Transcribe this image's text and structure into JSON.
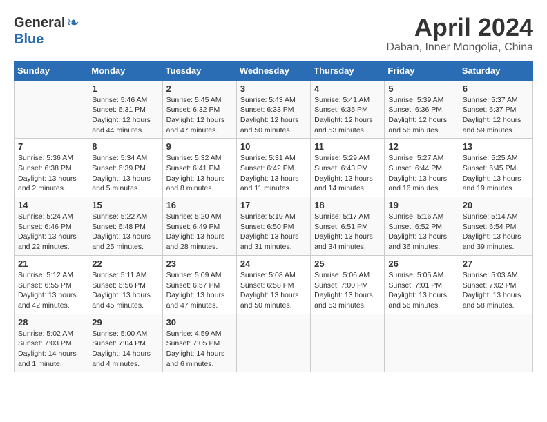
{
  "header": {
    "logo_general": "General",
    "logo_blue": "Blue",
    "month": "April 2024",
    "location": "Daban, Inner Mongolia, China"
  },
  "weekdays": [
    "Sunday",
    "Monday",
    "Tuesday",
    "Wednesday",
    "Thursday",
    "Friday",
    "Saturday"
  ],
  "weeks": [
    [
      {
        "day": "",
        "info": ""
      },
      {
        "day": "1",
        "info": "Sunrise: 5:46 AM\nSunset: 6:31 PM\nDaylight: 12 hours\nand 44 minutes."
      },
      {
        "day": "2",
        "info": "Sunrise: 5:45 AM\nSunset: 6:32 PM\nDaylight: 12 hours\nand 47 minutes."
      },
      {
        "day": "3",
        "info": "Sunrise: 5:43 AM\nSunset: 6:33 PM\nDaylight: 12 hours\nand 50 minutes."
      },
      {
        "day": "4",
        "info": "Sunrise: 5:41 AM\nSunset: 6:35 PM\nDaylight: 12 hours\nand 53 minutes."
      },
      {
        "day": "5",
        "info": "Sunrise: 5:39 AM\nSunset: 6:36 PM\nDaylight: 12 hours\nand 56 minutes."
      },
      {
        "day": "6",
        "info": "Sunrise: 5:37 AM\nSunset: 6:37 PM\nDaylight: 12 hours\nand 59 minutes."
      }
    ],
    [
      {
        "day": "7",
        "info": "Sunrise: 5:36 AM\nSunset: 6:38 PM\nDaylight: 13 hours\nand 2 minutes."
      },
      {
        "day": "8",
        "info": "Sunrise: 5:34 AM\nSunset: 6:39 PM\nDaylight: 13 hours\nand 5 minutes."
      },
      {
        "day": "9",
        "info": "Sunrise: 5:32 AM\nSunset: 6:41 PM\nDaylight: 13 hours\nand 8 minutes."
      },
      {
        "day": "10",
        "info": "Sunrise: 5:31 AM\nSunset: 6:42 PM\nDaylight: 13 hours\nand 11 minutes."
      },
      {
        "day": "11",
        "info": "Sunrise: 5:29 AM\nSunset: 6:43 PM\nDaylight: 13 hours\nand 14 minutes."
      },
      {
        "day": "12",
        "info": "Sunrise: 5:27 AM\nSunset: 6:44 PM\nDaylight: 13 hours\nand 16 minutes."
      },
      {
        "day": "13",
        "info": "Sunrise: 5:25 AM\nSunset: 6:45 PM\nDaylight: 13 hours\nand 19 minutes."
      }
    ],
    [
      {
        "day": "14",
        "info": "Sunrise: 5:24 AM\nSunset: 6:46 PM\nDaylight: 13 hours\nand 22 minutes."
      },
      {
        "day": "15",
        "info": "Sunrise: 5:22 AM\nSunset: 6:48 PM\nDaylight: 13 hours\nand 25 minutes."
      },
      {
        "day": "16",
        "info": "Sunrise: 5:20 AM\nSunset: 6:49 PM\nDaylight: 13 hours\nand 28 minutes."
      },
      {
        "day": "17",
        "info": "Sunrise: 5:19 AM\nSunset: 6:50 PM\nDaylight: 13 hours\nand 31 minutes."
      },
      {
        "day": "18",
        "info": "Sunrise: 5:17 AM\nSunset: 6:51 PM\nDaylight: 13 hours\nand 34 minutes."
      },
      {
        "day": "19",
        "info": "Sunrise: 5:16 AM\nSunset: 6:52 PM\nDaylight: 13 hours\nand 36 minutes."
      },
      {
        "day": "20",
        "info": "Sunrise: 5:14 AM\nSunset: 6:54 PM\nDaylight: 13 hours\nand 39 minutes."
      }
    ],
    [
      {
        "day": "21",
        "info": "Sunrise: 5:12 AM\nSunset: 6:55 PM\nDaylight: 13 hours\nand 42 minutes."
      },
      {
        "day": "22",
        "info": "Sunrise: 5:11 AM\nSunset: 6:56 PM\nDaylight: 13 hours\nand 45 minutes."
      },
      {
        "day": "23",
        "info": "Sunrise: 5:09 AM\nSunset: 6:57 PM\nDaylight: 13 hours\nand 47 minutes."
      },
      {
        "day": "24",
        "info": "Sunrise: 5:08 AM\nSunset: 6:58 PM\nDaylight: 13 hours\nand 50 minutes."
      },
      {
        "day": "25",
        "info": "Sunrise: 5:06 AM\nSunset: 7:00 PM\nDaylight: 13 hours\nand 53 minutes."
      },
      {
        "day": "26",
        "info": "Sunrise: 5:05 AM\nSunset: 7:01 PM\nDaylight: 13 hours\nand 56 minutes."
      },
      {
        "day": "27",
        "info": "Sunrise: 5:03 AM\nSunset: 7:02 PM\nDaylight: 13 hours\nand 58 minutes."
      }
    ],
    [
      {
        "day": "28",
        "info": "Sunrise: 5:02 AM\nSunset: 7:03 PM\nDaylight: 14 hours\nand 1 minute."
      },
      {
        "day": "29",
        "info": "Sunrise: 5:00 AM\nSunset: 7:04 PM\nDaylight: 14 hours\nand 4 minutes."
      },
      {
        "day": "30",
        "info": "Sunrise: 4:59 AM\nSunset: 7:05 PM\nDaylight: 14 hours\nand 6 minutes."
      },
      {
        "day": "",
        "info": ""
      },
      {
        "day": "",
        "info": ""
      },
      {
        "day": "",
        "info": ""
      },
      {
        "day": "",
        "info": ""
      }
    ]
  ]
}
